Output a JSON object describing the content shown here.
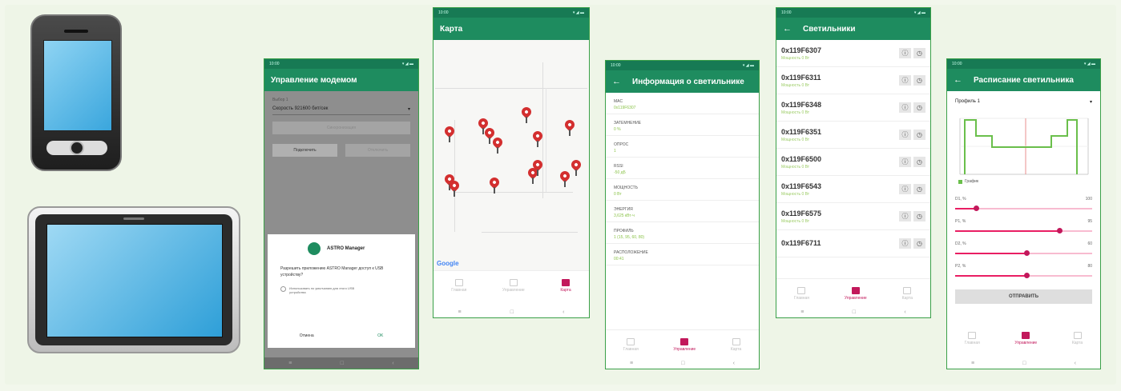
{
  "colors": {
    "primary": "#1e8c5f",
    "accent": "#c2185b",
    "pin": "#d32f2f"
  },
  "devices": {
    "phone": "phone-device",
    "tablet": "tablet-device"
  },
  "s1": {
    "title": "Управление модемом",
    "field_label": "Выбор 1",
    "select_value": "Скорость 921600 бит/сек",
    "btn_sync": "Синхронизация",
    "btn_connect": "Подключить",
    "btn_disconnect": "Отключить",
    "dialog_app": "ASTRO Manager",
    "dialog_text": "Разрешить приложению ASTRO Manager доступ к USB устройству?",
    "dialog_check": "Использовать по умолчанию для этого USB устройства",
    "cancel": "Отмена",
    "ok": "OK"
  },
  "s2": {
    "title": "Карта",
    "google": "Google",
    "nav": [
      "Главная",
      "Управление",
      "Карта"
    ]
  },
  "s3": {
    "title": "Информация о светильнике",
    "fields": [
      {
        "k": "MAC",
        "v": "0x119F6307"
      },
      {
        "k": "ЗАТЕМНЕНИЕ",
        "v": "0 %"
      },
      {
        "k": "ОПРОС",
        "v": "1"
      },
      {
        "k": "RSSI",
        "v": "-50 дБ"
      },
      {
        "k": "МОЩНОСТЬ",
        "v": "0 Вт"
      },
      {
        "k": "ЭНЕРГИЯ",
        "v": "3,625 кВт·ч"
      },
      {
        "k": "ПРОФИЛЬ",
        "v": "1 (15, 95, 60, 80)"
      },
      {
        "k": "РАСПОЛОЖЕНИЕ",
        "v": "00:41"
      }
    ],
    "nav": [
      "Главная",
      "Управление",
      "Карта"
    ]
  },
  "s4": {
    "title": "Светильники",
    "rows": [
      {
        "id": "0x119F6307",
        "sub": "Мощность 0 Вт"
      },
      {
        "id": "0x119F6311",
        "sub": "Мощность 0 Вт"
      },
      {
        "id": "0x119F6348",
        "sub": "Мощность 0 Вт"
      },
      {
        "id": "0x119F6351",
        "sub": "Мощность 0 Вт"
      },
      {
        "id": "0x119F6500",
        "sub": "Мощность 0 Вт"
      },
      {
        "id": "0x119F6543",
        "sub": "Мощность 0 Вт"
      },
      {
        "id": "0x119F6575",
        "sub": "Мощность 0 Вт"
      },
      {
        "id": "0x119F6711",
        "sub": ""
      }
    ],
    "nav": [
      "Главная",
      "Управление",
      "Карта"
    ]
  },
  "s5": {
    "title": "Расписание светильника",
    "profile": "Профиль 1",
    "legend": "График",
    "sliders": [
      {
        "label": "D1, %",
        "max": "100",
        "value": 0.15
      },
      {
        "label": "P1, %",
        "max": "95",
        "value": 0.76
      },
      {
        "label": "D2, %",
        "max": "60",
        "value": 0.52
      },
      {
        "label": "P2, %",
        "max": "80",
        "value": 0.52
      }
    ],
    "send": "ОТПРАВИТЬ",
    "nav": [
      "Главная",
      "Управление",
      "Карта"
    ]
  }
}
